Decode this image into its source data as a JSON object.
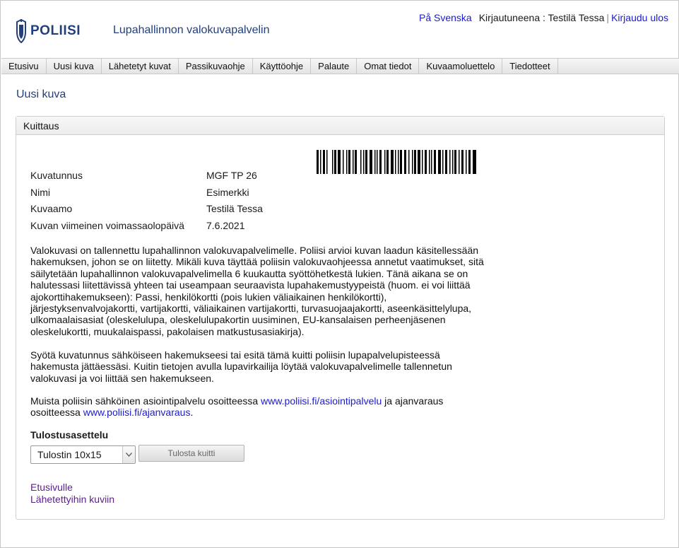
{
  "header": {
    "logo_text": "POLIISI",
    "app_title": "Lupahallinnon valokuvapalvelin",
    "lang_link": "På Svenska",
    "logged_in_label": "Kirjautuneena : Testilä Tessa",
    "separator": "|",
    "logout_link": "Kirjaudu ulos"
  },
  "nav": {
    "items": [
      {
        "label": "Etusivu"
      },
      {
        "label": "Uusi kuva"
      },
      {
        "label": "Lähetetyt kuvat"
      },
      {
        "label": "Passikuvaohje"
      },
      {
        "label": "Käyttöohje"
      },
      {
        "label": "Palaute"
      },
      {
        "label": "Omat tiedot"
      },
      {
        "label": "Kuvaamoluettelo"
      },
      {
        "label": "Tiedotteet"
      }
    ]
  },
  "page_title": "Uusi kuva",
  "panel": {
    "title": "Kuittaus",
    "fields": [
      {
        "label": "Kuvatunnus",
        "value": "MGF TP 26"
      },
      {
        "label": "Nimi",
        "value": "Esimerkki"
      },
      {
        "label": "Kuvaamo",
        "value": "Testilä Tessa"
      },
      {
        "label": "Kuvan viimeinen voimassaolopäivä",
        "value": "7.6.2021"
      }
    ],
    "paragraph1": "Valokuvasi on tallennettu lupahallinnon valokuvapalvelimelle. Poliisi arvioi kuvan laadun käsitellessään hakemuksen, johon se on liitetty. Mikäli kuva täyttää poliisin valokuvaohjeessa annetut vaatimukset, sitä säilytetään lupahallinnon valokuvapalvelimella 6 kuukautta syöttöhetkestä lukien. Tänä aikana se on halutessasi liitettävissä yhteen tai useampaan seuraavista lupahakemustyypeistä (huom. ei voi liittää ajokorttihakemukseen): Passi, henkilökortti (pois lukien väliaikainen henkilökortti), järjestyksenvalvojakortti, vartijakortti, väliaikainen vartijakortti, turvasuojaajakortti, aseenkäsittelylupa, ulkomaalaisasiat (oleskelulupa, oleskelulupakortin uusiminen, EU-kansalaisen perheenjäsenen oleskelukortti, muukalaispassi, pakolaisen matkustusasiakirja).",
    "paragraph2": "Syötä kuvatunnus sähköiseen hakemukseesi tai esitä tämä kuitti poliisin lupapalvelupisteessä hakemusta jättäessäsi. Kuitin tietojen avulla lupavirkailija löytää valokuvapalvelimelle tallennetun valokuvasi ja voi liittää sen hakemukseen.",
    "paragraph3_pre": "Muista poliisin sähköinen asiointipalvelu osoitteessa ",
    "paragraph3_link1": "www.poliisi.fi/asiointipalvelu",
    "paragraph3_mid": " ja ajanvaraus osoitteessa ",
    "paragraph3_link2": "www.poliisi.fi/ajanvaraus",
    "paragraph3_post": ".",
    "print_label": "Tulostusasettelu",
    "print_select_value": "Tulostin 10x15",
    "print_button": "Tulosta kuitti",
    "link_home": "Etusivulle",
    "link_sent": "Lähetettyihin kuviin"
  },
  "colors": {
    "brand_blue": "#23407d",
    "link_blue": "#1a1ad6",
    "visited_link": "#5a1e8c"
  }
}
